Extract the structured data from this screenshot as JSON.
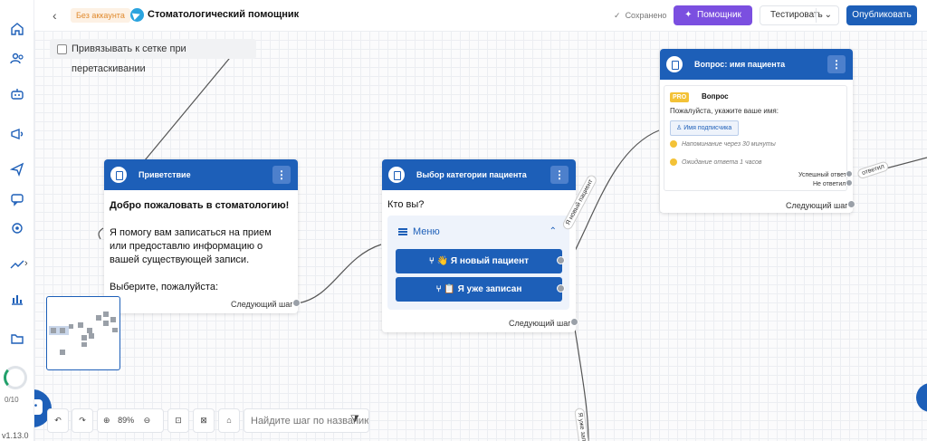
{
  "header": {
    "back_icon": "chevron-left-icon",
    "account_badge": "Без аккаунта",
    "channel_icon": "telegram-icon",
    "bot_title": "Стоматологический помощник",
    "saved_status": "Сохранено",
    "helper_button": "Помощник",
    "test_button": "Тестировать",
    "publish_button": "Опубликовать",
    "colors": {
      "primary": "#1d5fb8",
      "helper": "#7b4fe0",
      "badge": "#e08a2e"
    }
  },
  "sidebar": {
    "icons": [
      "home-icon",
      "users-icon",
      "bot-icon",
      "broadcast-icon",
      "send-icon",
      "chat-icon",
      "integrations-icon",
      "analytics-icon",
      "chart-icon",
      "folder-icon"
    ],
    "progress_label": "0/10",
    "version": "v1.13.0"
  },
  "canvas": {
    "snap_label": "Привязывать к сетке при перетаскивании",
    "nodes": {
      "welcome": {
        "title": "Приветствие",
        "heading": "Добро пожаловать в стоматологию!",
        "paragraph": "Я помогу вам записаться на прием или предоставлю информацию о вашей существующей записи.",
        "prompt": "Выберите, пожалуйста:",
        "next_step": "Следующий шаг"
      },
      "category": {
        "title": "Выбор категории пациента",
        "question": "Кто вы?",
        "menu_label": "Меню",
        "buttons": [
          "👋 Я новый пациент",
          "📋 Я уже записан"
        ],
        "next_step": "Следующий шаг"
      },
      "name": {
        "title": "Вопрос: имя пациента",
        "pro_badge": "PRO",
        "type_label": "Вопрос",
        "question_text": "Пожалуйста, укажите ваше имя:",
        "variable_chip": "Имя подписчика",
        "options": [
          "Напоминание через 30 минуты",
          "Ожидание ответа 1 часов"
        ],
        "outputs": [
          "Успешный ответ",
          "Не ответил"
        ],
        "next_step": "Следующий шаг"
      }
    },
    "edge_labels": [
      "Я новый пациент",
      "Я уже записан",
      "ответил"
    ]
  },
  "toolbar": {
    "zoom": "89%",
    "search_placeholder": "Найдите шаг по названию"
  }
}
